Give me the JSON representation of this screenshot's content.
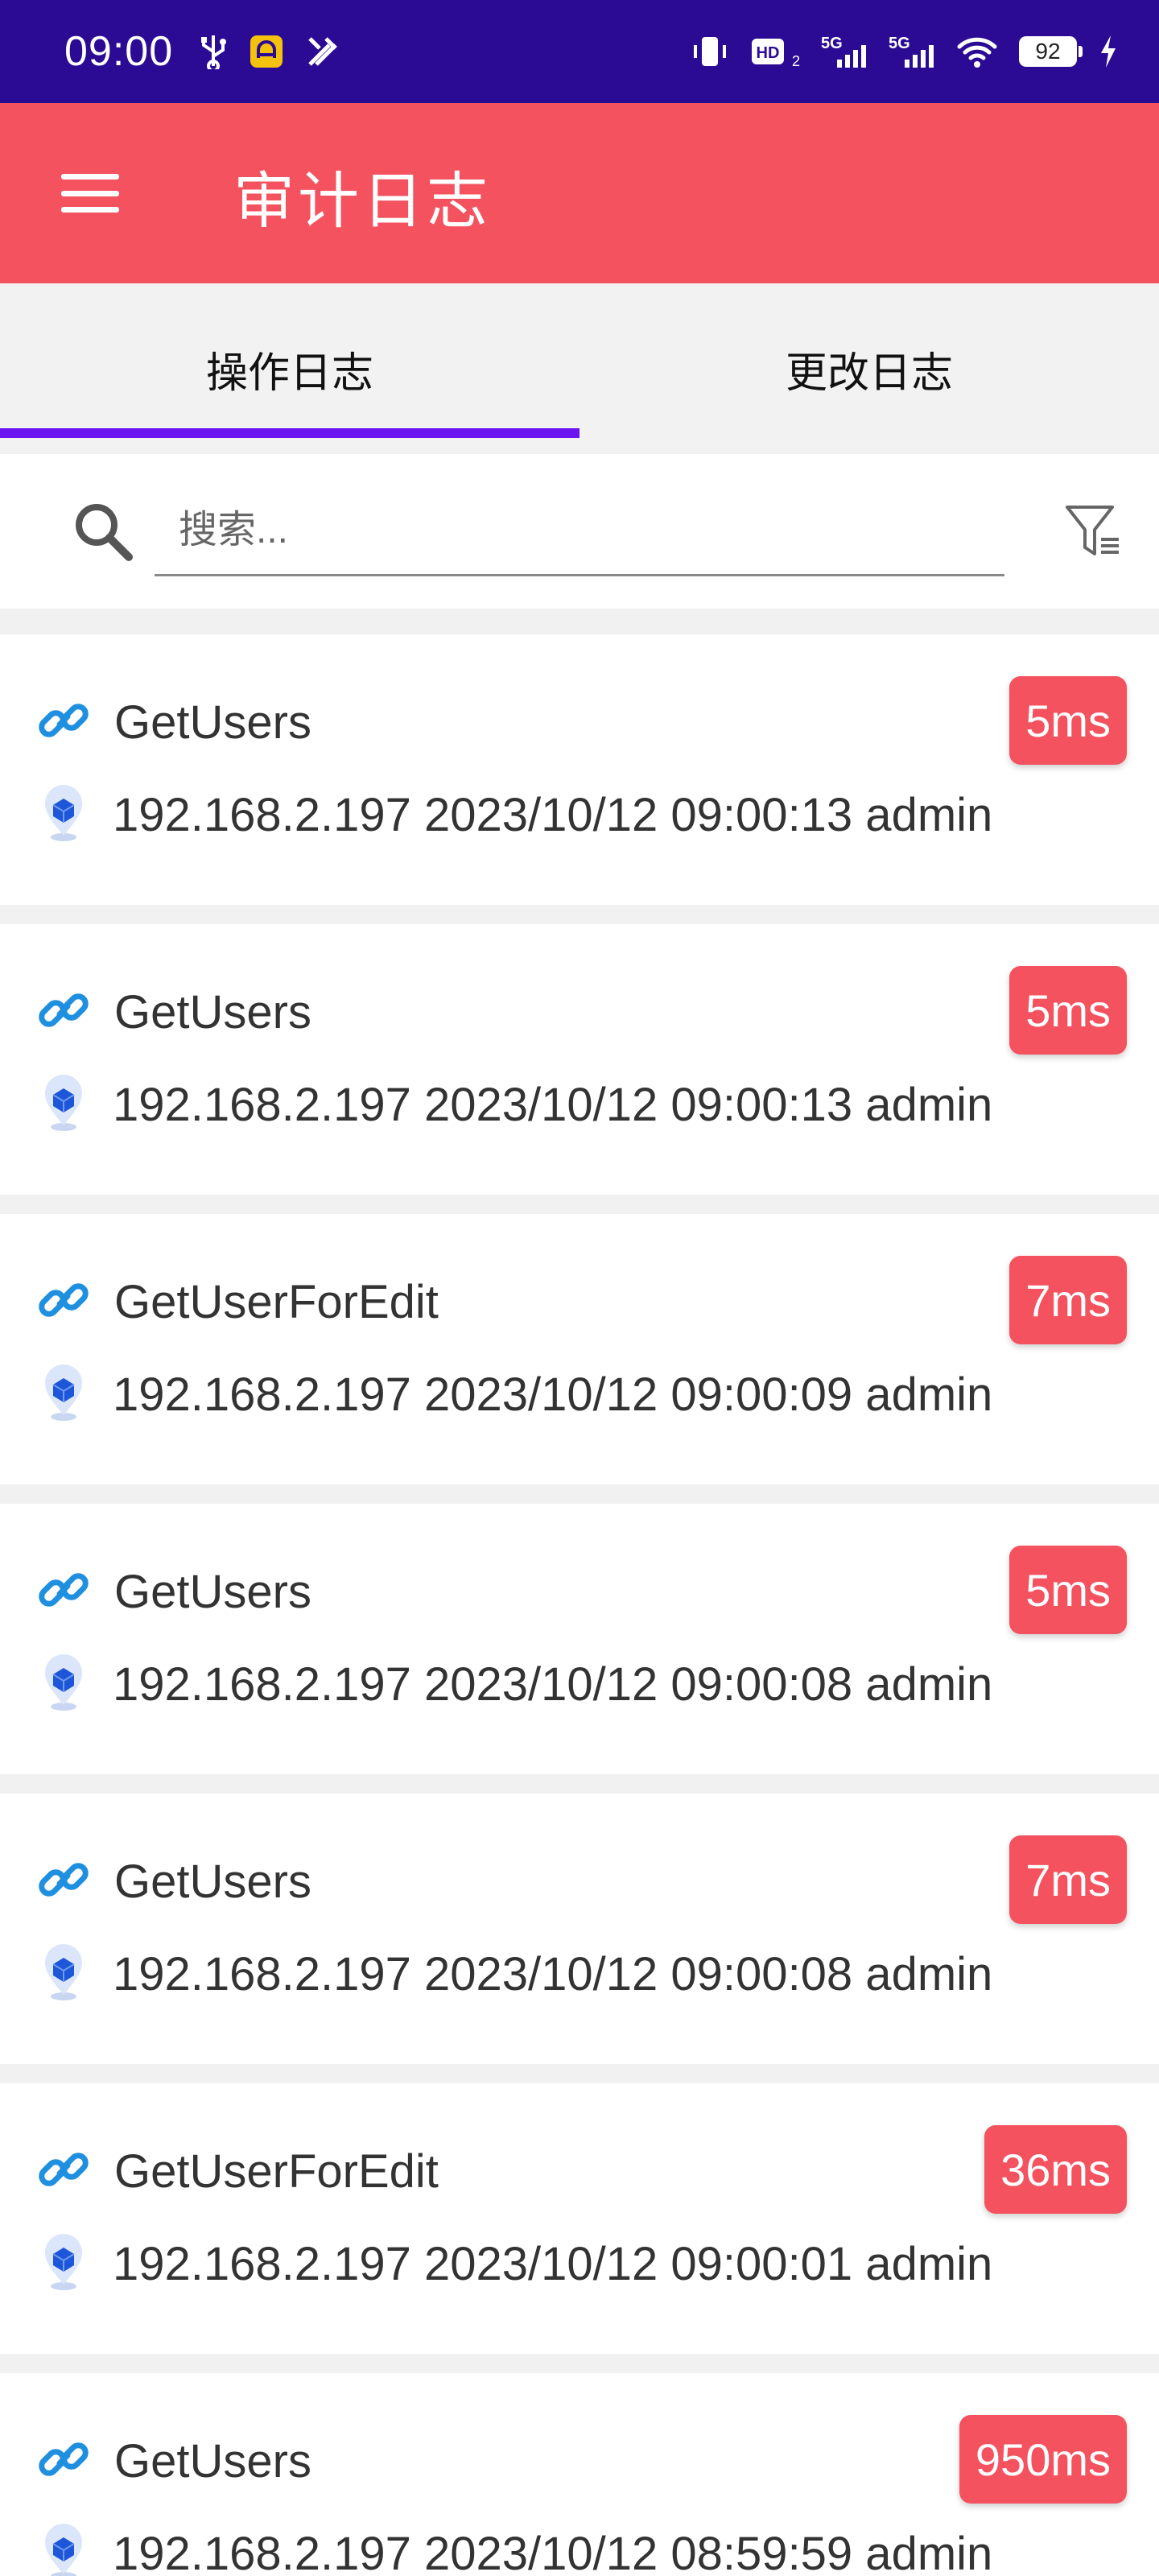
{
  "status_bar": {
    "time": "09:00",
    "battery": "92",
    "net_left": "HD",
    "net_5g_a": "5G",
    "net_5g_b": "5G"
  },
  "app_bar": {
    "title": "审计日志",
    "menu_icon": "hamburger-menu-icon"
  },
  "tabs": [
    {
      "label": "操作日志",
      "active": true
    },
    {
      "label": "更改日志",
      "active": false
    }
  ],
  "search": {
    "placeholder": "搜索...",
    "value": ""
  },
  "colors": {
    "status_bar": "#2c0b94",
    "app_bar": "#f4525f",
    "tab_indicator": "#6a14f0",
    "badge": "#f4525f"
  },
  "logs": [
    {
      "method": "GetUsers",
      "info": "192.168.2.197 2023/10/12 09:00:13 admin",
      "duration": "5ms"
    },
    {
      "method": "GetUsers",
      "info": "192.168.2.197 2023/10/12 09:00:13 admin",
      "duration": "5ms"
    },
    {
      "method": "GetUserForEdit",
      "info": "192.168.2.197 2023/10/12 09:00:09 admin",
      "duration": "7ms"
    },
    {
      "method": "GetUsers",
      "info": "192.168.2.197 2023/10/12 09:00:08 admin",
      "duration": "5ms"
    },
    {
      "method": "GetUsers",
      "info": "192.168.2.197 2023/10/12 09:00:08 admin",
      "duration": "7ms"
    },
    {
      "method": "GetUserForEdit",
      "info": "192.168.2.197 2023/10/12 09:00:01 admin",
      "duration": "36ms"
    },
    {
      "method": "GetUsers",
      "info": "192.168.2.197 2023/10/12 08:59:59 admin",
      "duration": "950ms"
    }
  ]
}
